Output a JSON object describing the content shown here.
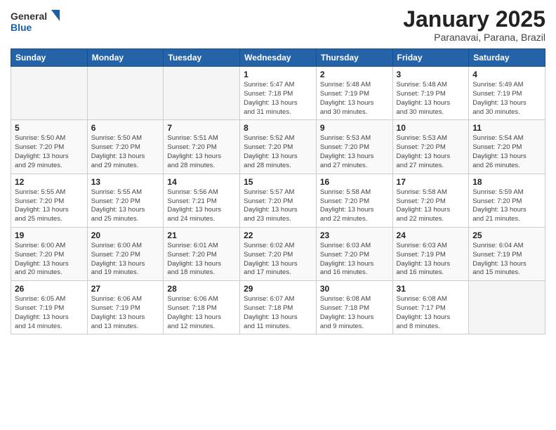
{
  "header": {
    "logo_line1": "General",
    "logo_line2": "Blue",
    "month": "January 2025",
    "location": "Paranavai, Parana, Brazil"
  },
  "days_of_week": [
    "Sunday",
    "Monday",
    "Tuesday",
    "Wednesday",
    "Thursday",
    "Friday",
    "Saturday"
  ],
  "weeks": [
    [
      {
        "day": "",
        "info": ""
      },
      {
        "day": "",
        "info": ""
      },
      {
        "day": "",
        "info": ""
      },
      {
        "day": "1",
        "info": "Sunrise: 5:47 AM\nSunset: 7:18 PM\nDaylight: 13 hours\nand 31 minutes."
      },
      {
        "day": "2",
        "info": "Sunrise: 5:48 AM\nSunset: 7:19 PM\nDaylight: 13 hours\nand 30 minutes."
      },
      {
        "day": "3",
        "info": "Sunrise: 5:48 AM\nSunset: 7:19 PM\nDaylight: 13 hours\nand 30 minutes."
      },
      {
        "day": "4",
        "info": "Sunrise: 5:49 AM\nSunset: 7:19 PM\nDaylight: 13 hours\nand 30 minutes."
      }
    ],
    [
      {
        "day": "5",
        "info": "Sunrise: 5:50 AM\nSunset: 7:20 PM\nDaylight: 13 hours\nand 29 minutes."
      },
      {
        "day": "6",
        "info": "Sunrise: 5:50 AM\nSunset: 7:20 PM\nDaylight: 13 hours\nand 29 minutes."
      },
      {
        "day": "7",
        "info": "Sunrise: 5:51 AM\nSunset: 7:20 PM\nDaylight: 13 hours\nand 28 minutes."
      },
      {
        "day": "8",
        "info": "Sunrise: 5:52 AM\nSunset: 7:20 PM\nDaylight: 13 hours\nand 28 minutes."
      },
      {
        "day": "9",
        "info": "Sunrise: 5:53 AM\nSunset: 7:20 PM\nDaylight: 13 hours\nand 27 minutes."
      },
      {
        "day": "10",
        "info": "Sunrise: 5:53 AM\nSunset: 7:20 PM\nDaylight: 13 hours\nand 27 minutes."
      },
      {
        "day": "11",
        "info": "Sunrise: 5:54 AM\nSunset: 7:20 PM\nDaylight: 13 hours\nand 26 minutes."
      }
    ],
    [
      {
        "day": "12",
        "info": "Sunrise: 5:55 AM\nSunset: 7:20 PM\nDaylight: 13 hours\nand 25 minutes."
      },
      {
        "day": "13",
        "info": "Sunrise: 5:55 AM\nSunset: 7:20 PM\nDaylight: 13 hours\nand 25 minutes."
      },
      {
        "day": "14",
        "info": "Sunrise: 5:56 AM\nSunset: 7:21 PM\nDaylight: 13 hours\nand 24 minutes."
      },
      {
        "day": "15",
        "info": "Sunrise: 5:57 AM\nSunset: 7:20 PM\nDaylight: 13 hours\nand 23 minutes."
      },
      {
        "day": "16",
        "info": "Sunrise: 5:58 AM\nSunset: 7:20 PM\nDaylight: 13 hours\nand 22 minutes."
      },
      {
        "day": "17",
        "info": "Sunrise: 5:58 AM\nSunset: 7:20 PM\nDaylight: 13 hours\nand 22 minutes."
      },
      {
        "day": "18",
        "info": "Sunrise: 5:59 AM\nSunset: 7:20 PM\nDaylight: 13 hours\nand 21 minutes."
      }
    ],
    [
      {
        "day": "19",
        "info": "Sunrise: 6:00 AM\nSunset: 7:20 PM\nDaylight: 13 hours\nand 20 minutes."
      },
      {
        "day": "20",
        "info": "Sunrise: 6:00 AM\nSunset: 7:20 PM\nDaylight: 13 hours\nand 19 minutes."
      },
      {
        "day": "21",
        "info": "Sunrise: 6:01 AM\nSunset: 7:20 PM\nDaylight: 13 hours\nand 18 minutes."
      },
      {
        "day": "22",
        "info": "Sunrise: 6:02 AM\nSunset: 7:20 PM\nDaylight: 13 hours\nand 17 minutes."
      },
      {
        "day": "23",
        "info": "Sunrise: 6:03 AM\nSunset: 7:20 PM\nDaylight: 13 hours\nand 16 minutes."
      },
      {
        "day": "24",
        "info": "Sunrise: 6:03 AM\nSunset: 7:19 PM\nDaylight: 13 hours\nand 16 minutes."
      },
      {
        "day": "25",
        "info": "Sunrise: 6:04 AM\nSunset: 7:19 PM\nDaylight: 13 hours\nand 15 minutes."
      }
    ],
    [
      {
        "day": "26",
        "info": "Sunrise: 6:05 AM\nSunset: 7:19 PM\nDaylight: 13 hours\nand 14 minutes."
      },
      {
        "day": "27",
        "info": "Sunrise: 6:06 AM\nSunset: 7:19 PM\nDaylight: 13 hours\nand 13 minutes."
      },
      {
        "day": "28",
        "info": "Sunrise: 6:06 AM\nSunset: 7:18 PM\nDaylight: 13 hours\nand 12 minutes."
      },
      {
        "day": "29",
        "info": "Sunrise: 6:07 AM\nSunset: 7:18 PM\nDaylight: 13 hours\nand 11 minutes."
      },
      {
        "day": "30",
        "info": "Sunrise: 6:08 AM\nSunset: 7:18 PM\nDaylight: 13 hours\nand 9 minutes."
      },
      {
        "day": "31",
        "info": "Sunrise: 6:08 AM\nSunset: 7:17 PM\nDaylight: 13 hours\nand 8 minutes."
      },
      {
        "day": "",
        "info": ""
      }
    ]
  ]
}
